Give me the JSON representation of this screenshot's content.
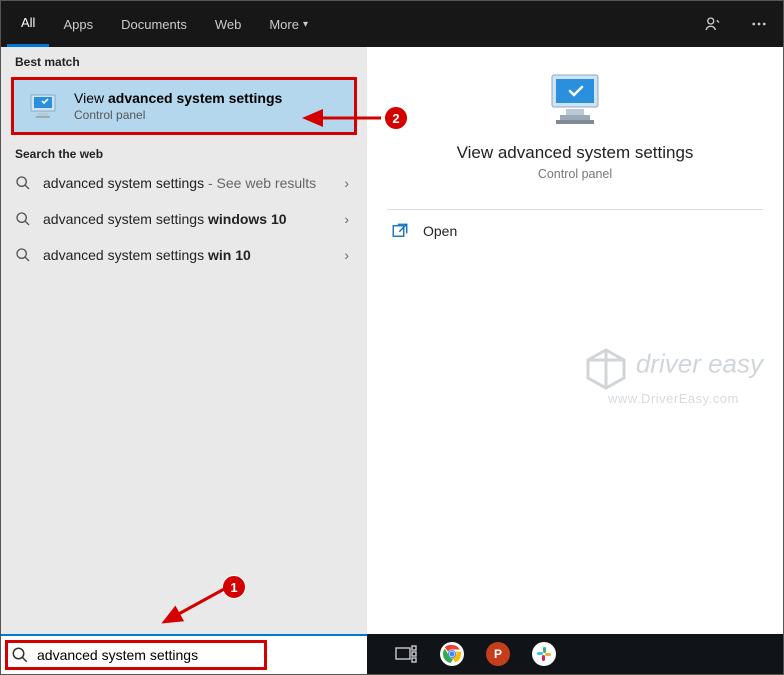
{
  "tabs": {
    "all": "All",
    "apps": "Apps",
    "documents": "Documents",
    "web": "Web",
    "more": "More"
  },
  "left": {
    "best_match_header": "Best match",
    "best_match_title_pre": "View ",
    "best_match_title_bold": "advanced system settings",
    "best_match_sub": "Control panel",
    "search_web_header": "Search the web",
    "web1_prefix": "advanced system settings",
    "web1_suffix": " - See web results",
    "web2_prefix": "advanced system settings ",
    "web2_bold": "windows 10",
    "web3_prefix": "advanced system settings ",
    "web3_bold": "win 10"
  },
  "right": {
    "title": "View advanced system settings",
    "sub": "Control panel",
    "open": "Open"
  },
  "watermark": {
    "line1": "driver easy",
    "line2": "www.DriverEasy.com"
  },
  "search": {
    "value": "advanced system settings"
  },
  "annot": {
    "one": "1",
    "two": "2"
  }
}
